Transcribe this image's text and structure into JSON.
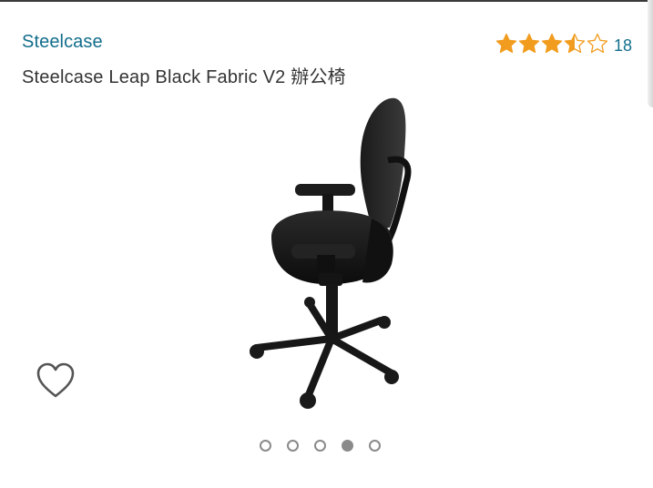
{
  "product": {
    "brand": "Steelcase",
    "title": "Steelcase Leap Black Fabric V2 辦公椅",
    "rating": 3.5,
    "rating_max": 5,
    "review_count": "18",
    "image_alt": "Steelcase Leap Black Fabric V2 辦公椅"
  },
  "colors": {
    "link": "#136e8c",
    "star": "#f19c1e",
    "text": "#333333"
  },
  "carousel": {
    "dot_count": 5,
    "active_index": 3
  },
  "icons": {
    "wishlist": "heart-outline-icon",
    "rating": "star-icon"
  }
}
